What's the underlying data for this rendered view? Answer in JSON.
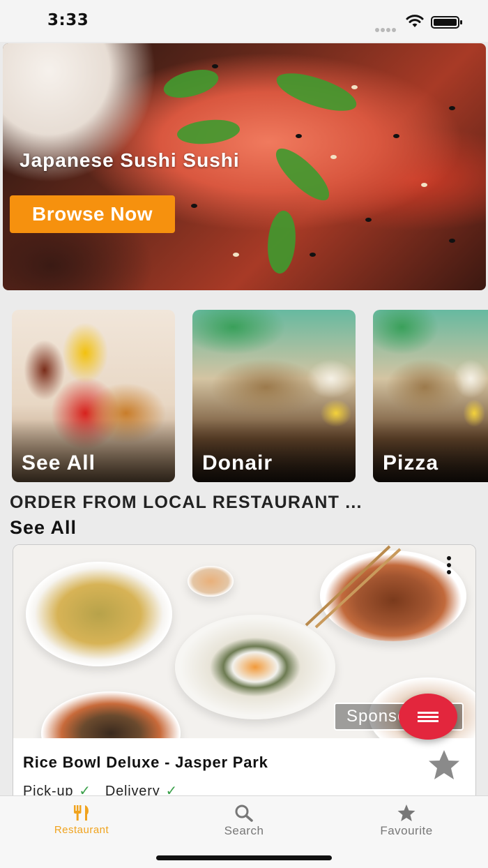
{
  "status_bar": {
    "time": "3:33"
  },
  "hero": {
    "title": "Japanese Sushi Sushi",
    "button_label": "Browse Now"
  },
  "categories": [
    {
      "label": "See All"
    },
    {
      "label": "Donair"
    },
    {
      "label": "Pizza"
    }
  ],
  "section": {
    "title": "ORDER FROM LOCAL RESTAURANT ...",
    "see_all": "See All"
  },
  "restaurant": {
    "name": "Rice Bowl Deluxe - Jasper Park",
    "badge": "Sponsored",
    "services": [
      {
        "label": "Pick-up",
        "check": "✓"
      },
      {
        "label": "Delivery",
        "check": "✓"
      }
    ]
  },
  "bottom_nav": {
    "items": [
      {
        "label": "Restaurant",
        "icon": "fork-knife-icon",
        "active": true
      },
      {
        "label": "Search",
        "icon": "search-icon",
        "active": false
      },
      {
        "label": "Favourite",
        "icon": "star-icon",
        "active": false
      }
    ]
  },
  "colors": {
    "accent_orange": "#f6910e",
    "fab_red": "#e3263d",
    "active_tab": "#f0a31e",
    "check_green": "#3aa04a"
  }
}
